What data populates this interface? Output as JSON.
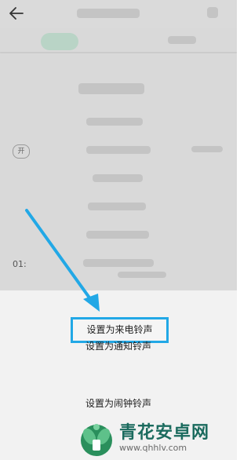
{
  "header": {
    "back_icon": "arrow-left-icon"
  },
  "background": {
    "toggle_label": "开",
    "time_text": "01:"
  },
  "sheet": {
    "options": [
      {
        "label": "设置为来电铃声",
        "highlighted": true
      },
      {
        "label": "设置为通知铃声",
        "highlighted": false
      },
      {
        "label": "设置为闹钟铃声",
        "highlighted": false
      }
    ]
  },
  "annotation": {
    "arrow_color": "#22a8e6"
  },
  "watermark": {
    "cn": "青花安卓网",
    "url": "www.qhhlv.com"
  },
  "colors": {
    "highlight_border": "#22a8e6",
    "sheet_bg": "#f2f2f2",
    "overlay": "#d9d9d9"
  }
}
